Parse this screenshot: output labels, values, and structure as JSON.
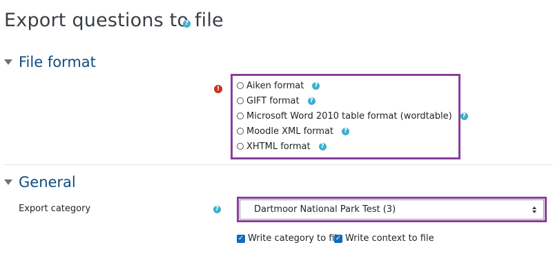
{
  "page": {
    "title": "Export questions to file",
    "title_help": "?"
  },
  "file_format_section": {
    "title": "File format",
    "required_icon": "!",
    "options": [
      {
        "label": "Aiken format",
        "help": "?"
      },
      {
        "label": "GIFT format",
        "help": "?"
      },
      {
        "label": "Microsoft Word 2010 table format (wordtable)",
        "help": "?"
      },
      {
        "label": "Moodle XML format",
        "help": "?"
      },
      {
        "label": "XHTML format",
        "help": "?"
      }
    ]
  },
  "general_section": {
    "title": "General",
    "export_category_label": "Export category",
    "export_category_help": "?",
    "export_category_value": "Dartmoor National Park Test (3)",
    "write_category_label": "Write category to file",
    "write_context_label": "Write context to file",
    "checkmark": "✓"
  },
  "colors": {
    "highlight_border": "#8a3d9c",
    "section_title": "#0f4c81",
    "help_icon": "#3ab0d0",
    "error_icon": "#ca3120",
    "checkbox": "#0f6cbf"
  }
}
